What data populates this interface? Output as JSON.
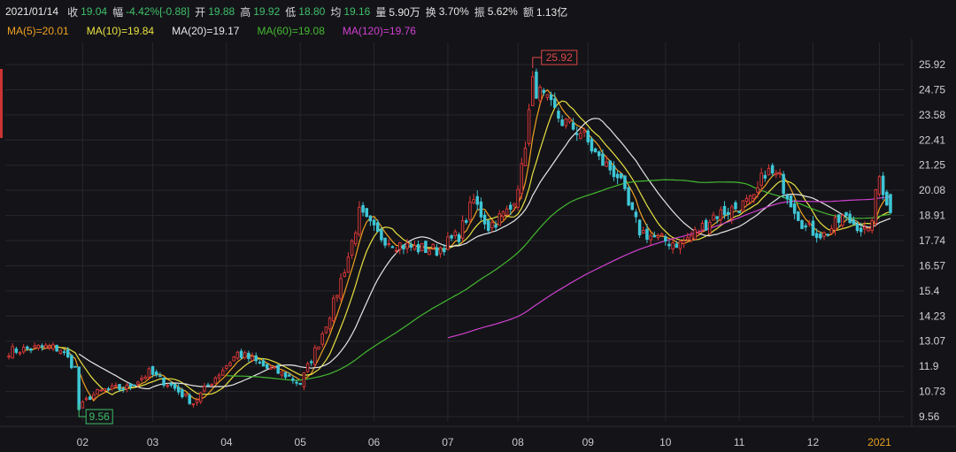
{
  "info": {
    "date": "2021/01/14",
    "close_label": "收",
    "close": "19.04",
    "change_label": "幅",
    "change": "-4.42%[-0.88]",
    "open_label": "开",
    "open": "19.88",
    "high_label": "高",
    "high": "19.92",
    "low_label": "低",
    "low": "18.80",
    "avg_label": "均",
    "avg": "19.16",
    "volume_label": "量",
    "volume": "5.90万",
    "turnover_label": "换",
    "turnover": "3.70%",
    "amplitude_label": "振",
    "amplitude": "5.62%",
    "amount_label": "额",
    "amount": "1.13亿"
  },
  "ma": [
    {
      "text": "MA(5)=20.01",
      "color": "#f0a020"
    },
    {
      "text": "MA(10)=19.84",
      "color": "#e8e040"
    },
    {
      "text": "MA(20)=19.17",
      "color": "#e6e6e6"
    },
    {
      "text": "MA(60)=19.08",
      "color": "#44b830"
    },
    {
      "text": "MA(120)=19.76",
      "color": "#d040d0"
    }
  ],
  "colors": {
    "up": "#e03838",
    "down": "#3fc6d6",
    "grid": "#26262c",
    "accent_year": "#e8a020"
  },
  "chart_data": {
    "type": "candlestick",
    "y_ticks": [
      "25.92",
      "24.75",
      "23.58",
      "22.41",
      "21.25",
      "20.08",
      "18.91",
      "17.74",
      "16.57",
      "15.4",
      "14.23",
      "13.07",
      "11.9",
      "10.73",
      "9.56"
    ],
    "x_ticks": [
      "02",
      "03",
      "04",
      "05",
      "06",
      "07",
      "08",
      "09",
      "10",
      "11",
      "12",
      "2021"
    ],
    "ylim": [
      9.0,
      26.8
    ],
    "max_annotation": "25.92",
    "min_annotation": "9.56",
    "candle_count": 240,
    "anchors": [
      [
        0,
        12.6
      ],
      [
        10,
        12.8
      ],
      [
        14,
        12.7
      ],
      [
        18,
        11.8
      ],
      [
        19,
        9.9
      ],
      [
        22,
        10.5
      ],
      [
        26,
        10.8
      ],
      [
        32,
        10.9
      ],
      [
        38,
        11.6
      ],
      [
        44,
        11.0
      ],
      [
        50,
        10.2
      ],
      [
        56,
        11.4
      ],
      [
        62,
        12.5
      ],
      [
        66,
        12.2
      ],
      [
        70,
        11.8
      ],
      [
        75,
        11.5
      ],
      [
        79,
        11.1
      ],
      [
        84,
        13.0
      ],
      [
        88,
        14.8
      ],
      [
        92,
        17.0
      ],
      [
        95,
        19.0
      ],
      [
        100,
        18.0
      ],
      [
        105,
        17.6
      ],
      [
        110,
        17.4
      ],
      [
        116,
        17.3
      ],
      [
        122,
        18.0
      ],
      [
        126,
        19.6
      ],
      [
        130,
        18.4
      ],
      [
        136,
        19.2
      ],
      [
        139,
        21.0
      ],
      [
        142,
        25.0
      ],
      [
        145,
        24.3
      ],
      [
        150,
        23.3
      ],
      [
        155,
        22.8
      ],
      [
        160,
        21.5
      ],
      [
        165,
        20.8
      ],
      [
        168,
        19.3
      ],
      [
        171,
        18.2
      ],
      [
        176,
        17.8
      ],
      [
        182,
        17.6
      ],
      [
        187,
        18.2
      ],
      [
        191,
        18.9
      ],
      [
        196,
        19.2
      ],
      [
        202,
        19.6
      ],
      [
        205,
        21.0
      ],
      [
        209,
        20.6
      ],
      [
        212,
        19.6
      ],
      [
        216,
        18.3
      ],
      [
        221,
        18.0
      ],
      [
        226,
        18.8
      ],
      [
        230,
        18.5
      ],
      [
        233,
        18.0
      ],
      [
        236,
        20.7
      ],
      [
        239,
        19.04
      ]
    ]
  }
}
